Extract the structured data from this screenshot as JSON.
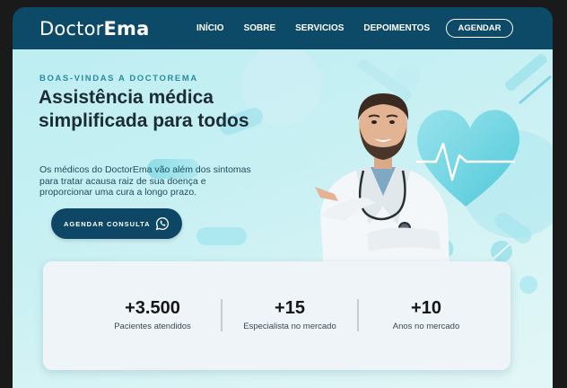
{
  "navbar": {
    "logo_light": "Doctor",
    "logo_bold": "Ema",
    "links": [
      "INÍCIO",
      "SOBRE",
      "SERVICIOS",
      "DEPOIMENTOS"
    ],
    "cta_label": "AGENDAR"
  },
  "hero": {
    "eyebrow": "BOAS-VINDAS A DOCTOREMA",
    "headline": "Assistência médica simplificada para todos",
    "subtext": "Os médicos do DoctorEma vão além dos sintomas para tratar acausa raiz de sua doença e proporcionar uma cura a longo prazo.",
    "cta_label": "AGENDAR CONSULTA",
    "cta_icon": "whatsapp-icon"
  },
  "stats": [
    {
      "value": "+3.500",
      "label": "Pacientes atendidos"
    },
    {
      "value": "+15",
      "label": "Especialista no mercado"
    },
    {
      "value": "+10",
      "label": "Anos no mercado"
    }
  ],
  "colors": {
    "navbar": "#0d4a68",
    "accent": "#2a8aa0",
    "button": "#0e4766",
    "card": "#eef4f8"
  }
}
